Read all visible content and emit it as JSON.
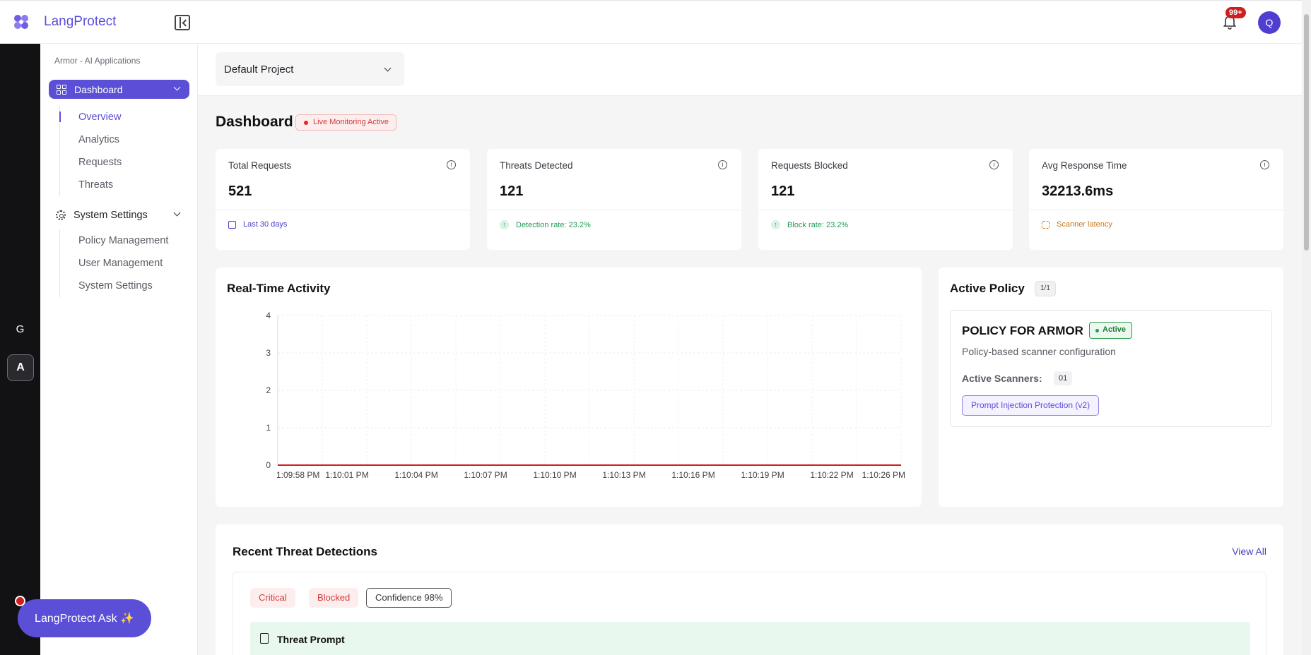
{
  "app": {
    "name": "LangProtect",
    "notifications_badge": "99+",
    "avatar_initial": "Q",
    "accent": "#5b4fd8"
  },
  "rail": {
    "items": [
      "G",
      "A"
    ]
  },
  "sidebar": {
    "breadcrumb": "Armor - AI Applications",
    "dashboard_label": "Dashboard",
    "dashboard_items": [
      "Overview",
      "Analytics",
      "Requests",
      "Threats"
    ],
    "settings_label": "System Settings",
    "settings_items": [
      "Policy Management",
      "User Management",
      "System Settings"
    ]
  },
  "project": {
    "selected": "Default Project"
  },
  "page": {
    "title": "Dashboard",
    "live_badge": "Live Monitoring Active"
  },
  "stats": [
    {
      "label": "Total Requests",
      "value": "521",
      "foot": "Last 30 days",
      "foot_icon": "calendar-icon",
      "color": "#4a40c7"
    },
    {
      "label": "Threats Detected",
      "value": "121",
      "foot": "Detection rate: 23.2%",
      "foot_icon": "arrow-up-icon",
      "color": "#1f9d55"
    },
    {
      "label": "Requests Blocked",
      "value": "121",
      "foot": "Block rate: 23.2%",
      "foot_icon": "arrow-up-icon",
      "color": "#1f9d55"
    },
    {
      "label": "Avg Response Time",
      "value": "32213.6ms",
      "foot": "Scanner latency",
      "foot_icon": "scan-icon",
      "color": "#c9771a"
    }
  ],
  "activity": {
    "title": "Real-Time Activity"
  },
  "chart_data": {
    "type": "line",
    "x": [
      "1:09:58 PM",
      "1:10:01 PM",
      "1:10:04 PM",
      "1:10:07 PM",
      "1:10:10 PM",
      "1:10:13 PM",
      "1:10:16 PM",
      "1:10:19 PM",
      "1:10:22 PM",
      "1:10:26 PM"
    ],
    "series": [
      {
        "values": [
          0,
          0,
          0,
          0,
          0,
          0,
          0,
          0,
          0,
          0
        ],
        "color": "#d01d1d"
      }
    ],
    "yticks": [
      0,
      1,
      2,
      3,
      4
    ],
    "ylim": [
      0,
      4
    ],
    "grid": true
  },
  "policy": {
    "title": "Active Policy",
    "count": "1/1",
    "name": "POLICY FOR ARMOR",
    "status": "Active",
    "description": "Policy-based scanner configuration",
    "scanners_label": "Active Scanners:",
    "scanners_count": "01",
    "scanner": "Prompt Injection Protection (v2)"
  },
  "recent": {
    "title": "Recent Threat Detections",
    "view_all": "View All",
    "tags": [
      "Critical",
      "Blocked",
      "Confidence 98%"
    ],
    "prompt_label": "Threat Prompt"
  },
  "ask": {
    "label": "LangProtect Ask ✨"
  }
}
